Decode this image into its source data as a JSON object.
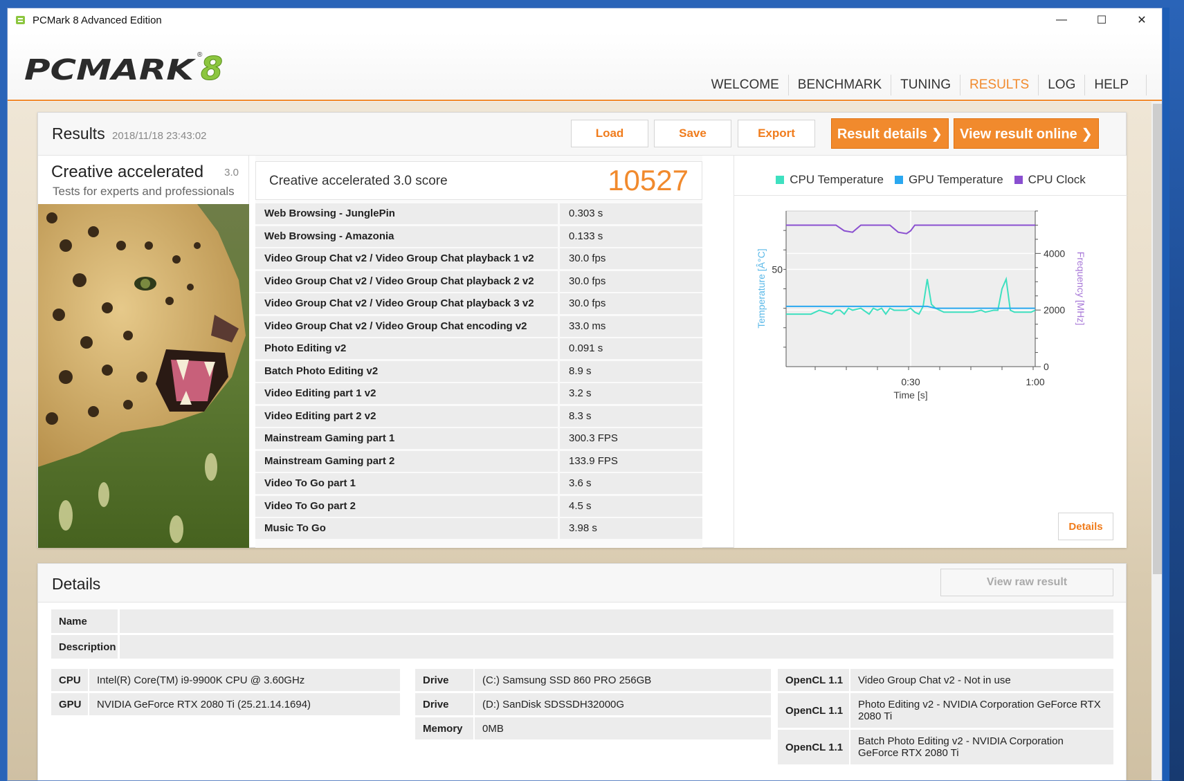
{
  "window": {
    "title": "PCMark 8 Advanced Edition",
    "minimize": "—",
    "maximize": "☐",
    "close": "✕"
  },
  "header": {
    "logo_text": "PCMARK",
    "logo_version": "8",
    "nav": [
      {
        "label": "WELCOME",
        "active": false
      },
      {
        "label": "BENCHMARK",
        "active": false
      },
      {
        "label": "TUNING",
        "active": false
      },
      {
        "label": "RESULTS",
        "active": true
      },
      {
        "label": "LOG",
        "active": false
      },
      {
        "label": "HELP",
        "active": false
      }
    ]
  },
  "results": {
    "title": "Results",
    "date": "2018/11/18 23:43:02",
    "load_label": "Load",
    "save_label": "Save",
    "export_label": "Export",
    "result_details_label": "Result details ❯",
    "view_online_label": "View result online ❯",
    "test_name": "Creative accelerated",
    "test_version": "3.0",
    "test_desc": "Tests for experts and professionals",
    "score_label": "Creative accelerated 3.0 score",
    "score_value": "10527",
    "subtests": [
      {
        "name": "Web Browsing - JunglePin",
        "value": "0.303 s"
      },
      {
        "name": "Web Browsing - Amazonia",
        "value": "0.133 s"
      },
      {
        "name": "Video Group Chat v2 / Video Group Chat playback 1 v2",
        "value": "30.0 fps"
      },
      {
        "name": "Video Group Chat v2 / Video Group Chat playback 2 v2",
        "value": "30.0 fps"
      },
      {
        "name": "Video Group Chat v2 / Video Group Chat playback 3 v2",
        "value": "30.0 fps"
      },
      {
        "name": "Video Group Chat v2 / Video Group Chat encoding v2",
        "value": "33.0 ms"
      },
      {
        "name": "Photo Editing v2",
        "value": "0.091 s"
      },
      {
        "name": "Batch Photo Editing v2",
        "value": "8.9 s"
      },
      {
        "name": "Video Editing part 1 v2",
        "value": "3.2 s"
      },
      {
        "name": "Video Editing part 2 v2",
        "value": "8.3 s"
      },
      {
        "name": "Mainstream Gaming part 1",
        "value": "300.3 FPS"
      },
      {
        "name": "Mainstream Gaming part 2",
        "value": "133.9 FPS"
      },
      {
        "name": "Video To Go part 1",
        "value": "3.6 s"
      },
      {
        "name": "Video To Go part 2",
        "value": "4.5 s"
      },
      {
        "name": "Music To Go",
        "value": "3.98 s"
      }
    ],
    "details_label": "Details"
  },
  "chart_data": {
    "type": "line",
    "xlabel": "Time [s]",
    "ylabel_left": "Temperature [Â°C]",
    "ylabel_right": "Frequency [MHz]",
    "x_ticks": [
      "0:30",
      "1:00"
    ],
    "y_left_ticks": [
      "50"
    ],
    "y_right_ticks": [
      "4000",
      "2000",
      "0"
    ],
    "x_range": [
      0,
      60
    ],
    "y_left_range": [
      0,
      80
    ],
    "y_right_range": [
      0,
      5500
    ],
    "grid": true,
    "legend_position": "top",
    "series": [
      {
        "name": "CPU Temperature",
        "color": "#3ee0c0",
        "axis": "left",
        "x": [
          0,
          3,
          6,
          8,
          11,
          12,
          13,
          14,
          15,
          16,
          18,
          20,
          21,
          22,
          23,
          24,
          25,
          26,
          28,
          29,
          30,
          31,
          32,
          33,
          34,
          35,
          36,
          37,
          38,
          40,
          45,
          47,
          48,
          50,
          51,
          52,
          53,
          54,
          55,
          56,
          57,
          58,
          59,
          60
        ],
        "y": [
          27,
          27,
          27,
          29,
          27,
          29,
          29,
          27,
          30,
          29,
          30,
          27,
          30,
          29,
          30,
          27,
          30,
          29,
          29,
          29,
          30,
          28,
          27,
          31,
          45,
          32,
          30,
          29,
          28,
          28,
          28,
          29,
          28,
          29,
          29,
          40,
          45,
          29,
          28,
          28,
          28,
          28,
          28,
          29
        ]
      },
      {
        "name": "GPU Temperature",
        "color": "#2aa8f0",
        "axis": "left",
        "x": [
          0,
          10,
          20,
          30,
          34,
          36,
          38,
          40,
          50,
          60
        ],
        "y": [
          31,
          31,
          31,
          31,
          31,
          30,
          30,
          30,
          30,
          30
        ]
      },
      {
        "name": "CPU Clock",
        "color": "#8a4fd0",
        "axis": "right",
        "x": [
          0,
          12,
          14,
          16,
          18,
          25,
          27,
          29,
          30,
          31,
          32,
          34,
          40,
          50,
          60
        ],
        "y": [
          5000,
          5000,
          4800,
          4750,
          5000,
          5000,
          4750,
          4700,
          4800,
          5000,
          5000,
          5000,
          5000,
          5000,
          5000
        ]
      }
    ]
  },
  "details": {
    "title": "Details",
    "raw_label": "View raw result",
    "name_key": "Name",
    "name_val": "",
    "desc_key": "Description",
    "desc_val": "",
    "col1": [
      {
        "key": "CPU",
        "value": "Intel(R) Core(TM) i9-9900K CPU @ 3.60GHz"
      },
      {
        "key": "GPU",
        "value": "NVIDIA GeForce RTX 2080 Ti (25.21.14.1694)"
      }
    ],
    "col2": [
      {
        "key": "Drive",
        "value": "(C:) Samsung SSD 860 PRO 256GB"
      },
      {
        "key": "Drive",
        "value": "(D:) SanDisk SDSSDH32000G"
      },
      {
        "key": "Memory",
        "value": "0MB"
      }
    ],
    "col3": [
      {
        "key": "OpenCL 1.1",
        "value": "Video Group Chat v2 - Not in use"
      },
      {
        "key": "OpenCL 1.1",
        "value": "Photo Editing v2 - NVIDIA Corporation GeForce RTX 2080 Ti"
      },
      {
        "key": "OpenCL 1.1",
        "value": "Batch Photo Editing v2 - NVIDIA Corporation GeForce RTX 2080 Ti"
      }
    ]
  }
}
